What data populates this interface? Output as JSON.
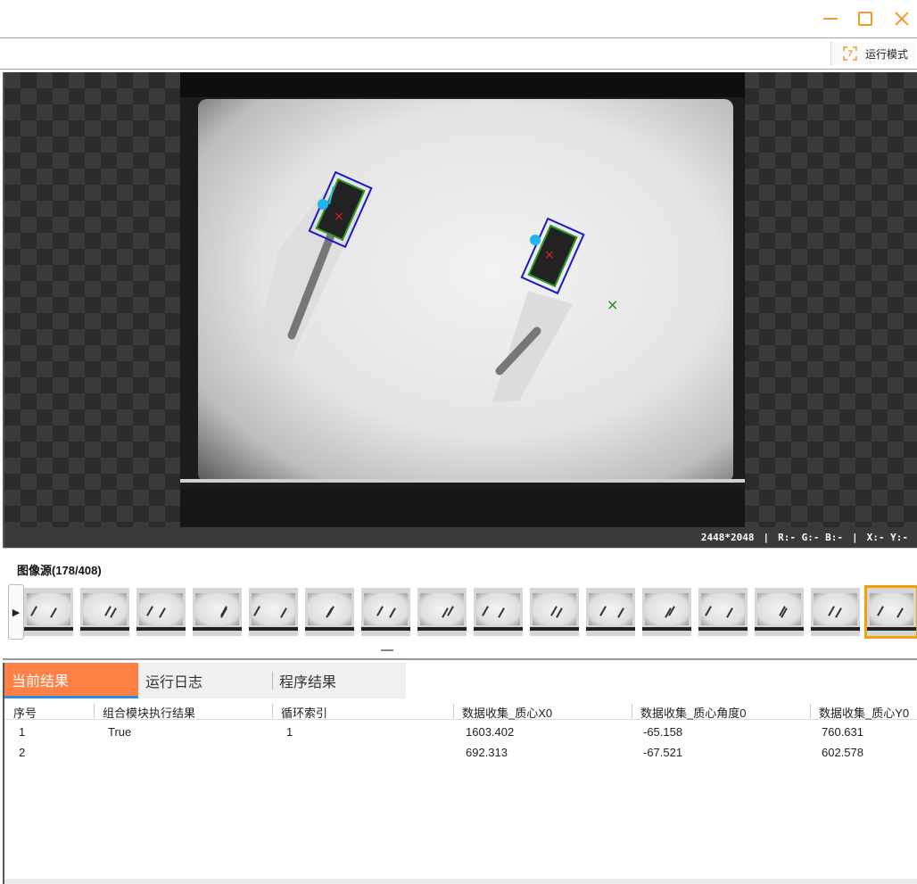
{
  "window": {
    "minimize_icon": "minimize-icon",
    "maximize_icon": "maximize-icon",
    "close_icon": "close-icon",
    "accent_color": "#f29b2a"
  },
  "toolbar": {
    "run_mode_label": "运行模式",
    "run_mode_icon": "run-mode-icon"
  },
  "viewer": {
    "resolution": "2448*2048",
    "rgb_readout": "R:- G:- B:-",
    "xy_readout": "X:- Y:-"
  },
  "filmstrip": {
    "title": "图像源(178/408)",
    "play_icon": "▶",
    "current_index": 178,
    "total": 408,
    "thumbnail_count": 16,
    "selected_thumbnail": 16,
    "selection_color": "#f5a000"
  },
  "results": {
    "tabs": [
      {
        "label": "当前结果",
        "active": true
      },
      {
        "label": "运行日志",
        "active": false
      },
      {
        "label": "程序结果",
        "active": false
      }
    ],
    "active_tab_color": "#ff7f45",
    "columns": [
      "序号",
      "组合模块执行结果",
      "循环索引",
      "数据收集_质心X0",
      "数据收集_质心角度0",
      "数据收集_质心Y0"
    ],
    "rows": [
      [
        "1",
        "True",
        "1",
        "1603.402",
        "-65.158",
        "760.631"
      ],
      [
        "2",
        "",
        "",
        "692.313",
        "-67.521",
        "602.578"
      ]
    ]
  }
}
